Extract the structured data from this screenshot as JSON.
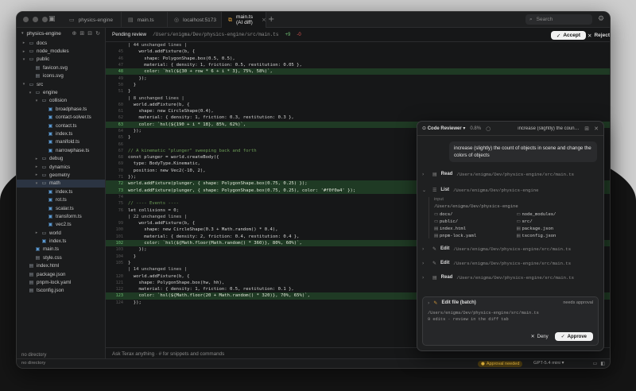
{
  "titlebar": {
    "tabs": [
      {
        "label": "physics-engine",
        "icon": "folder-icon"
      },
      {
        "label": "main.ts",
        "icon": "file-icon"
      },
      {
        "label": "localhost:5173",
        "icon": "globe-icon"
      },
      {
        "label": "main.ts (AI diff)",
        "icon": "diff-icon"
      }
    ],
    "search_placeholder": "Search"
  },
  "sidebar": {
    "project": "physics-engine",
    "footer": "no directory",
    "tree": [
      {
        "label": "docs",
        "depth": 0,
        "kind": "folder",
        "open": false
      },
      {
        "label": "node_modules",
        "depth": 0,
        "kind": "folder",
        "open": false
      },
      {
        "label": "public",
        "depth": 0,
        "kind": "folder",
        "open": true
      },
      {
        "label": "favicon.svg",
        "depth": 1,
        "kind": "file"
      },
      {
        "label": "icons.svg",
        "depth": 1,
        "kind": "file"
      },
      {
        "label": "src",
        "depth": 0,
        "kind": "folder",
        "open": true
      },
      {
        "label": "engine",
        "depth": 1,
        "kind": "folder",
        "open": true
      },
      {
        "label": "collision",
        "depth": 2,
        "kind": "folder",
        "open": true
      },
      {
        "label": "broadphase.ts",
        "depth": 3,
        "kind": "ts"
      },
      {
        "label": "contact-solver.ts",
        "depth": 3,
        "kind": "ts"
      },
      {
        "label": "contact.ts",
        "depth": 3,
        "kind": "ts"
      },
      {
        "label": "index.ts",
        "depth": 3,
        "kind": "ts"
      },
      {
        "label": "manifold.ts",
        "depth": 3,
        "kind": "ts"
      },
      {
        "label": "narrowphase.ts",
        "depth": 3,
        "kind": "ts"
      },
      {
        "label": "debug",
        "depth": 2,
        "kind": "folder",
        "open": false
      },
      {
        "label": "dynamics",
        "depth": 2,
        "kind": "folder",
        "open": false
      },
      {
        "label": "geometry",
        "depth": 2,
        "kind": "folder",
        "open": false
      },
      {
        "label": "math",
        "depth": 2,
        "kind": "folder",
        "open": true,
        "selected": true
      },
      {
        "label": "index.ts",
        "depth": 3,
        "kind": "ts"
      },
      {
        "label": "rot.ts",
        "depth": 3,
        "kind": "ts"
      },
      {
        "label": "scalar.ts",
        "depth": 3,
        "kind": "ts"
      },
      {
        "label": "transform.ts",
        "depth": 3,
        "kind": "ts"
      },
      {
        "label": "vec2.ts",
        "depth": 3,
        "kind": "ts"
      },
      {
        "label": "world",
        "depth": 2,
        "kind": "folder",
        "open": false
      },
      {
        "label": "index.ts",
        "depth": 2,
        "kind": "ts"
      },
      {
        "label": "main.ts",
        "depth": 1,
        "kind": "ts"
      },
      {
        "label": "style.css",
        "depth": 1,
        "kind": "file"
      },
      {
        "label": "index.html",
        "depth": 0,
        "kind": "file"
      },
      {
        "label": "package.json",
        "depth": 0,
        "kind": "file"
      },
      {
        "label": "pnpm-lock.yaml",
        "depth": 0,
        "kind": "file"
      },
      {
        "label": "tsconfig.json",
        "depth": 0,
        "kind": "file"
      }
    ]
  },
  "review": {
    "status": "Pending review",
    "path": "/Users/enigma/Dev/physics-engine/src/main.ts",
    "additions": "+9",
    "deletions": "-0",
    "accept_label": "Accept",
    "reject_label": "Reject"
  },
  "code_lines": [
    {
      "n": "",
      "t": "unch",
      "text": "| 44 unchanged lines |"
    },
    {
      "n": "45",
      "t": "",
      "text": "    world.addFixture(b, {"
    },
    {
      "n": "46",
      "t": "",
      "text": "      shape: PolygonShape.box(0.5, 0.5),"
    },
    {
      "n": "47",
      "t": "",
      "text": "      material: { density: 1, friction: 0.5, restitution: 0.05 },"
    },
    {
      "n": "48",
      "t": "add",
      "text": "      color: `hsl(${30 + row * 6 + i * 3}, 75%, 58%)`,"
    },
    {
      "n": "49",
      "t": "",
      "text": "    });"
    },
    {
      "n": "50",
      "t": "",
      "text": "  }"
    },
    {
      "n": "51",
      "t": "",
      "text": "}"
    },
    {
      "n": "",
      "t": "unch",
      "text": "| 8 unchanged lines |"
    },
    {
      "n": "60",
      "t": "",
      "text": "  world.addFixture(b, {"
    },
    {
      "n": "61",
      "t": "",
      "text": "    shape: new CircleShape(0.4),"
    },
    {
      "n": "62",
      "t": "",
      "text": "    material: { density: 1, friction: 0.3, restitution: 0.3 },"
    },
    {
      "n": "63",
      "t": "add",
      "text": "    color: `hsl(${190 + i * 18}, 85%, 62%)`,"
    },
    {
      "n": "64",
      "t": "",
      "text": "  });"
    },
    {
      "n": "65",
      "t": "",
      "text": "}"
    },
    {
      "n": "66",
      "t": "",
      "text": ""
    },
    {
      "n": "67",
      "t": "",
      "text": "// A kinematic \"plunger\" sweeping back and forth"
    },
    {
      "n": "68",
      "t": "",
      "text": "const plunger = world.createBody({"
    },
    {
      "n": "69",
      "t": "",
      "text": "  type: BodyType.Kinematic,"
    },
    {
      "n": "70",
      "t": "",
      "text": "  position: new Vec2(-10, 2),"
    },
    {
      "n": "71",
      "t": "",
      "text": "});"
    },
    {
      "n": "72",
      "t": "add",
      "text": "world.addFixture(plunger, { shape: PolygonShape.box(0.75, 0.25) });"
    },
    {
      "n": "73",
      "t": "add",
      "text": "world.addFixture(plunger, { shape: PolygonShape.box(0.75, 0.25), color: '#f0f0a4' });"
    },
    {
      "n": "74",
      "t": "",
      "text": ""
    },
    {
      "n": "75",
      "t": "",
      "text": "// ---- Events ----"
    },
    {
      "n": "76",
      "t": "",
      "text": "let collisions = 0;"
    },
    {
      "n": "",
      "t": "unch",
      "text": "| 22 unchanged lines |"
    },
    {
      "n": "99",
      "t": "",
      "text": "    world.addFixture(b, {"
    },
    {
      "n": "100",
      "t": "",
      "text": "      shape: new CircleShape(0.3 + Math.random() * 0.4),"
    },
    {
      "n": "101",
      "t": "",
      "text": "      material: { density: 2, friction: 0.4, restitution: 0.4 },"
    },
    {
      "n": "102",
      "t": "add",
      "text": "      color: `hsl(${Math.floor(Math.random() * 360)}, 80%, 60%)`,"
    },
    {
      "n": "103",
      "t": "",
      "text": "    });"
    },
    {
      "n": "104",
      "t": "",
      "text": "  }"
    },
    {
      "n": "105",
      "t": "",
      "text": "}"
    },
    {
      "n": "",
      "t": "unch",
      "text": "| 14 unchanged lines |"
    },
    {
      "n": "120",
      "t": "",
      "text": "  world.addFixture(b, {"
    },
    {
      "n": "121",
      "t": "",
      "text": "    shape: PolygonShape.box(hw, hh),"
    },
    {
      "n": "122",
      "t": "",
      "text": "    material: { density: 1, friction: 0.5, restitution: 0.1 },"
    },
    {
      "n": "123",
      "t": "add",
      "text": "    color: `hsl(${Math.floor(20 + Math.random() * 320)}, 70%, 65%)`,"
    },
    {
      "n": "124",
      "t": "",
      "text": "  });"
    }
  ],
  "ask_bar": {
    "placeholder": "Ask Terax anything  ·  # for snippets and commands"
  },
  "statusbar": {
    "left": "no directory",
    "approval": "Approval needed",
    "model": "GPT-5.4 mini"
  },
  "chat": {
    "agent": "Code Reviewer",
    "context_pct": "0.8%",
    "title": "increase (slightly) the count o...",
    "user_message": "increase (slightly) the count of objects in scene and change the colors of objects",
    "read1": {
      "label": "Read",
      "path": "/Users/enigma/Dev/physics-engine/src/main.ts"
    },
    "list": {
      "label": "List",
      "path": "/Users/enigma/Dev/physics-engine",
      "input_label": "input",
      "input_path": "/Users/enigma/Dev/physics-engine",
      "entries": [
        "docs/",
        "node_modules/",
        "public/",
        "src/",
        "index.html",
        "package.json",
        "pnpm-lock.yaml",
        "tsconfig.json"
      ]
    },
    "edit1": {
      "label": "Edit",
      "path": "/Users/enigma/Dev/physics-engine/src/main.ts"
    },
    "edit2": {
      "label": "Edit",
      "path": "/Users/enigma/Dev/physics-engine/src/main.ts"
    },
    "read2": {
      "label": "Read",
      "path": "/Users/enigma/Dev/physics-engine/src/main.ts"
    },
    "edit_card": {
      "title": "Edit file (batch)",
      "needs": "needs approval",
      "path": "/Users/enigma/Dev/physics-engine/src/main.ts",
      "summary": "9 edits · review in the diff tab",
      "deny_label": "Deny",
      "approve_label": "Approve"
    }
  }
}
